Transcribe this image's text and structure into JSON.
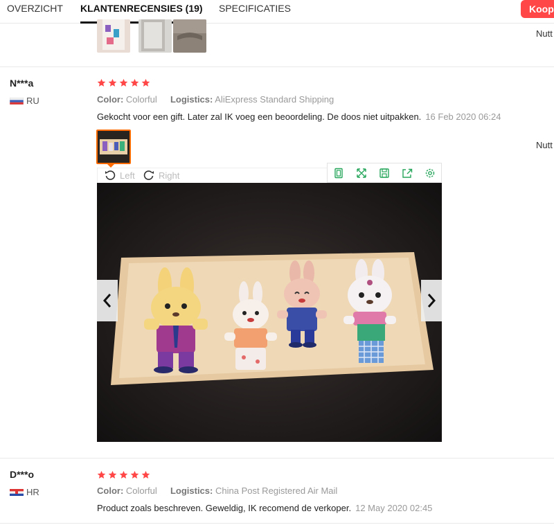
{
  "tabs": [
    {
      "label": "OVERZICHT",
      "active": false
    },
    {
      "label": "KLANTENRECENSIES (19)",
      "active": true
    },
    {
      "label": "SPECIFICATIES",
      "active": false
    }
  ],
  "buy_button": "Koop",
  "useful_label": "Nutt",
  "reviews": [
    {
      "buyer": "N***a",
      "country": "RU",
      "stars": 5,
      "color_label": "Color:",
      "color_value": "Colorful",
      "logistics_label": "Logistics:",
      "logistics_value": "AliExpress Standard Shipping",
      "text": "Gekocht voor een gift. Later zal IK voeg een beoordeling. De doos niet uitpakken.",
      "date": "16 Feb 2020 06:24"
    },
    {
      "buyer": "D***o",
      "country": "HR",
      "stars": 5,
      "color_label": "Color:",
      "color_value": "Colorful",
      "logistics_label": "Logistics:",
      "logistics_value": "China Post Registered Air Mail",
      "text": "Product zoals beschreven. Geweldig, IK recomend de verkoper.",
      "date": "12 May 2020 02:45"
    }
  ],
  "viewer": {
    "rotate_left": "Left",
    "rotate_right": "Right",
    "tools": [
      "fit-icon",
      "fullscreen-icon",
      "save-icon",
      "share-icon",
      "settings-icon"
    ]
  },
  "colors": {
    "accent": "#ff4747",
    "star": "#ff4747",
    "tool_green": "#26a65b",
    "thumb_border": "#ff6a00"
  }
}
